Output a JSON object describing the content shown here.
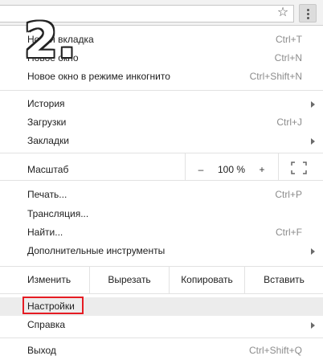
{
  "toolbar": {
    "star_icon": "star-outline-icon",
    "menu_icon": "vertical-ellipsis-icon"
  },
  "annotation": {
    "step_number": "2.",
    "highlight_color": "#e51c23"
  },
  "menu": {
    "new_tab": {
      "label": "Новая вкладка",
      "shortcut": "Ctrl+T"
    },
    "new_window": {
      "label": "Новое окно",
      "shortcut": "Ctrl+N"
    },
    "incognito": {
      "label": "Новое окно в режиме инкогнито",
      "shortcut": "Ctrl+Shift+N"
    },
    "history": {
      "label": "История"
    },
    "downloads": {
      "label": "Загрузки",
      "shortcut": "Ctrl+J"
    },
    "bookmarks": {
      "label": "Закладки"
    },
    "zoom": {
      "label": "Масштаб",
      "minus": "–",
      "value": "100 %",
      "plus": "+"
    },
    "print": {
      "label": "Печать...",
      "shortcut": "Ctrl+P"
    },
    "cast": {
      "label": "Трансляция..."
    },
    "find": {
      "label": "Найти...",
      "shortcut": "Ctrl+F"
    },
    "more_tools": {
      "label": "Дополнительные инструменты"
    },
    "edit": {
      "label": "Изменить",
      "cut": "Вырезать",
      "copy": "Копировать",
      "paste": "Вставить"
    },
    "settings": {
      "label": "Настройки"
    },
    "help": {
      "label": "Справка"
    },
    "exit": {
      "label": "Выход",
      "shortcut": "Ctrl+Shift+Q"
    }
  }
}
